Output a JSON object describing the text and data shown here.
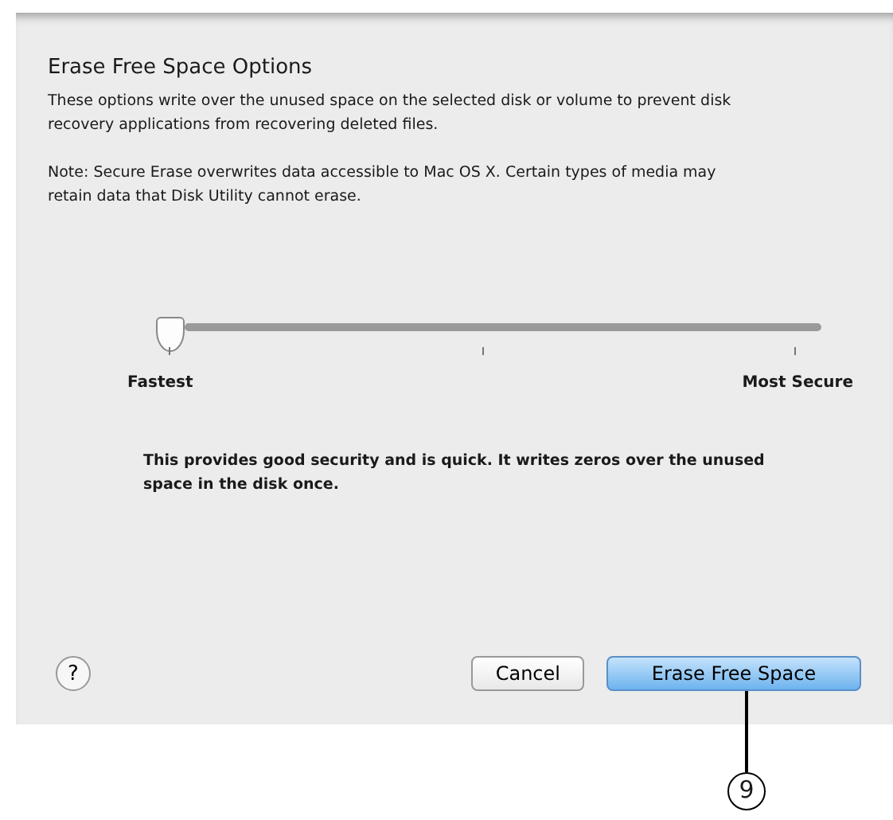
{
  "sheet": {
    "title": "Erase Free Space Options",
    "description": "These options write over the unused space on the selected disk or volume to prevent disk recovery applications from recovering deleted files.",
    "note": "Note: Secure Erase overwrites data accessible to Mac OS X.  Certain types of media may retain data that Disk Utility cannot erase.",
    "slider": {
      "level": 0,
      "min_label": "Fastest",
      "max_label": "Most Secure"
    },
    "explanation": "This provides good security and is quick. It writes zeros over the unused space in the disk once.",
    "help": "?",
    "buttons": [
      {
        "label": "Cancel",
        "kind": "normal"
      },
      {
        "label": "Erase Free Space",
        "kind": "default"
      }
    ]
  },
  "callout": {
    "label": "9"
  }
}
